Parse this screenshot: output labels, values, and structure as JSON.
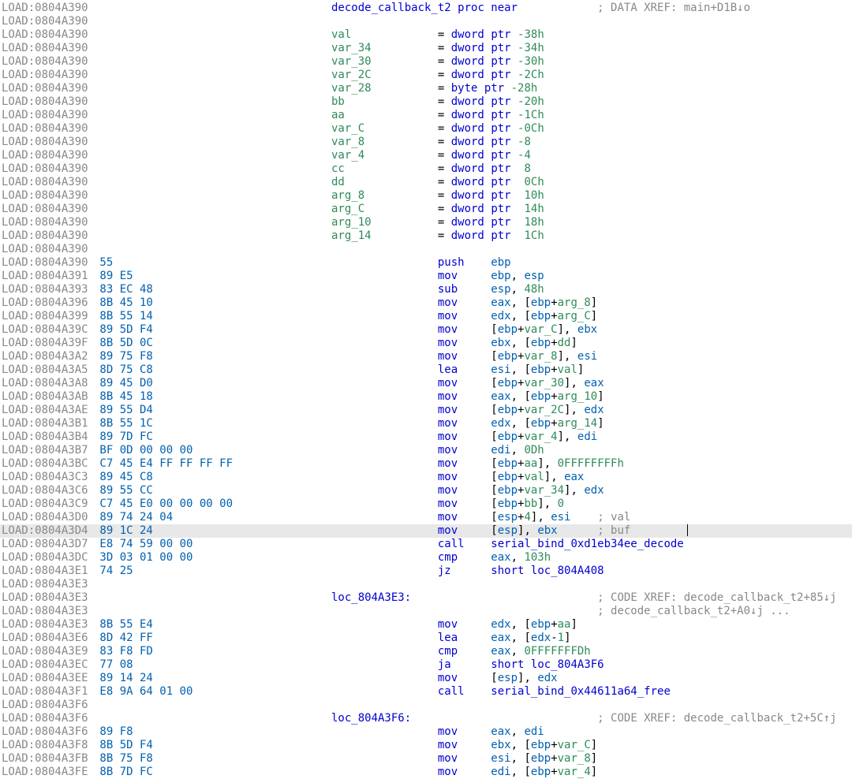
{
  "segment": "LOAD",
  "header_addr": "0804A390",
  "proc_name": "decode_callback_t2",
  "proc_keyword": "proc near",
  "proc_xref": "; DATA XREF: main+D1B↓o",
  "vars": [
    {
      "name": "val",
      "type": "dword",
      "off": "-38h"
    },
    {
      "name": "var_34",
      "type": "dword",
      "off": "-34h"
    },
    {
      "name": "var_30",
      "type": "dword",
      "off": "-30h"
    },
    {
      "name": "var_2C",
      "type": "dword",
      "off": "-2Ch"
    },
    {
      "name": "var_28",
      "type": "byte",
      "off": "-28h"
    },
    {
      "name": "bb",
      "type": "dword",
      "off": "-20h"
    },
    {
      "name": "aa",
      "type": "dword",
      "off": "-1Ch"
    },
    {
      "name": "var_C",
      "type": "dword",
      "off": "-0Ch"
    },
    {
      "name": "var_8",
      "type": "dword",
      "off": "-8"
    },
    {
      "name": "var_4",
      "type": "dword",
      "off": "-4"
    },
    {
      "name": "cc",
      "type": "dword",
      "off": " 8"
    },
    {
      "name": "dd",
      "type": "dword",
      "off": " 0Ch"
    },
    {
      "name": "arg_8",
      "type": "dword",
      "off": " 10h"
    },
    {
      "name": "arg_C",
      "type": "dword",
      "off": " 14h"
    },
    {
      "name": "arg_10",
      "type": "dword",
      "off": " 18h"
    },
    {
      "name": "arg_14",
      "type": "dword",
      "off": " 1Ch"
    }
  ],
  "rows": [
    {
      "addr": "0804A390",
      "bytes": "55",
      "mnem": "push",
      "ops": [
        {
          "t": "reg",
          "v": "ebp"
        }
      ]
    },
    {
      "addr": "0804A391",
      "bytes": "89 E5",
      "mnem": "mov",
      "ops": [
        {
          "t": "reg",
          "v": "ebp"
        },
        {
          "t": "p",
          "v": ", "
        },
        {
          "t": "reg",
          "v": "esp"
        }
      ]
    },
    {
      "addr": "0804A393",
      "bytes": "83 EC 48",
      "mnem": "sub",
      "ops": [
        {
          "t": "reg",
          "v": "esp"
        },
        {
          "t": "p",
          "v": ", "
        },
        {
          "t": "num",
          "v": "48h"
        }
      ]
    },
    {
      "addr": "0804A396",
      "bytes": "8B 45 10",
      "mnem": "mov",
      "ops": [
        {
          "t": "reg",
          "v": "eax"
        },
        {
          "t": "p",
          "v": ", ["
        },
        {
          "t": "reg",
          "v": "ebp"
        },
        {
          "t": "p",
          "v": "+"
        },
        {
          "t": "var",
          "v": "arg_8"
        },
        {
          "t": "p",
          "v": "]"
        }
      ]
    },
    {
      "addr": "0804A399",
      "bytes": "8B 55 14",
      "mnem": "mov",
      "ops": [
        {
          "t": "reg",
          "v": "edx"
        },
        {
          "t": "p",
          "v": ", ["
        },
        {
          "t": "reg",
          "v": "ebp"
        },
        {
          "t": "p",
          "v": "+"
        },
        {
          "t": "var",
          "v": "arg_C"
        },
        {
          "t": "p",
          "v": "]"
        }
      ]
    },
    {
      "addr": "0804A39C",
      "bytes": "89 5D F4",
      "mnem": "mov",
      "ops": [
        {
          "t": "p",
          "v": "["
        },
        {
          "t": "reg",
          "v": "ebp"
        },
        {
          "t": "p",
          "v": "+"
        },
        {
          "t": "var",
          "v": "var_C"
        },
        {
          "t": "p",
          "v": "], "
        },
        {
          "t": "reg",
          "v": "ebx"
        }
      ]
    },
    {
      "addr": "0804A39F",
      "bytes": "8B 5D 0C",
      "mnem": "mov",
      "ops": [
        {
          "t": "reg",
          "v": "ebx"
        },
        {
          "t": "p",
          "v": ", ["
        },
        {
          "t": "reg",
          "v": "ebp"
        },
        {
          "t": "p",
          "v": "+"
        },
        {
          "t": "var",
          "v": "dd"
        },
        {
          "t": "p",
          "v": "]"
        }
      ]
    },
    {
      "addr": "0804A3A2",
      "bytes": "89 75 F8",
      "mnem": "mov",
      "ops": [
        {
          "t": "p",
          "v": "["
        },
        {
          "t": "reg",
          "v": "ebp"
        },
        {
          "t": "p",
          "v": "+"
        },
        {
          "t": "var",
          "v": "var_8"
        },
        {
          "t": "p",
          "v": "], "
        },
        {
          "t": "reg",
          "v": "esi"
        }
      ]
    },
    {
      "addr": "0804A3A5",
      "bytes": "8D 75 C8",
      "mnem": "lea",
      "ops": [
        {
          "t": "reg",
          "v": "esi"
        },
        {
          "t": "p",
          "v": ", ["
        },
        {
          "t": "reg",
          "v": "ebp"
        },
        {
          "t": "p",
          "v": "+"
        },
        {
          "t": "var",
          "v": "val"
        },
        {
          "t": "p",
          "v": "]"
        }
      ]
    },
    {
      "addr": "0804A3A8",
      "bytes": "89 45 D0",
      "mnem": "mov",
      "ops": [
        {
          "t": "p",
          "v": "["
        },
        {
          "t": "reg",
          "v": "ebp"
        },
        {
          "t": "p",
          "v": "+"
        },
        {
          "t": "var",
          "v": "var_30"
        },
        {
          "t": "p",
          "v": "], "
        },
        {
          "t": "reg",
          "v": "eax"
        }
      ]
    },
    {
      "addr": "0804A3AB",
      "bytes": "8B 45 18",
      "mnem": "mov",
      "ops": [
        {
          "t": "reg",
          "v": "eax"
        },
        {
          "t": "p",
          "v": ", ["
        },
        {
          "t": "reg",
          "v": "ebp"
        },
        {
          "t": "p",
          "v": "+"
        },
        {
          "t": "var",
          "v": "arg_10"
        },
        {
          "t": "p",
          "v": "]"
        }
      ]
    },
    {
      "addr": "0804A3AE",
      "bytes": "89 55 D4",
      "mnem": "mov",
      "ops": [
        {
          "t": "p",
          "v": "["
        },
        {
          "t": "reg",
          "v": "ebp"
        },
        {
          "t": "p",
          "v": "+"
        },
        {
          "t": "var",
          "v": "var_2C"
        },
        {
          "t": "p",
          "v": "], "
        },
        {
          "t": "reg",
          "v": "edx"
        }
      ]
    },
    {
      "addr": "0804A3B1",
      "bytes": "8B 55 1C",
      "mnem": "mov",
      "ops": [
        {
          "t": "reg",
          "v": "edx"
        },
        {
          "t": "p",
          "v": ", ["
        },
        {
          "t": "reg",
          "v": "ebp"
        },
        {
          "t": "p",
          "v": "+"
        },
        {
          "t": "var",
          "v": "arg_14"
        },
        {
          "t": "p",
          "v": "]"
        }
      ]
    },
    {
      "addr": "0804A3B4",
      "bytes": "89 7D FC",
      "mnem": "mov",
      "ops": [
        {
          "t": "p",
          "v": "["
        },
        {
          "t": "reg",
          "v": "ebp"
        },
        {
          "t": "p",
          "v": "+"
        },
        {
          "t": "var",
          "v": "var_4"
        },
        {
          "t": "p",
          "v": "], "
        },
        {
          "t": "reg",
          "v": "edi"
        }
      ]
    },
    {
      "addr": "0804A3B7",
      "bytes": "BF 0D 00 00 00",
      "mnem": "mov",
      "ops": [
        {
          "t": "reg",
          "v": "edi"
        },
        {
          "t": "p",
          "v": ", "
        },
        {
          "t": "num",
          "v": "0Dh"
        }
      ]
    },
    {
      "addr": "0804A3BC",
      "bytes": "C7 45 E4 FF FF FF FF",
      "mnem": "mov",
      "ops": [
        {
          "t": "p",
          "v": "["
        },
        {
          "t": "reg",
          "v": "ebp"
        },
        {
          "t": "p",
          "v": "+"
        },
        {
          "t": "var",
          "v": "aa"
        },
        {
          "t": "p",
          "v": "], "
        },
        {
          "t": "num",
          "v": "0FFFFFFFFh"
        }
      ]
    },
    {
      "addr": "0804A3C3",
      "bytes": "89 45 C8",
      "mnem": "mov",
      "ops": [
        {
          "t": "p",
          "v": "["
        },
        {
          "t": "reg",
          "v": "ebp"
        },
        {
          "t": "p",
          "v": "+"
        },
        {
          "t": "var",
          "v": "val"
        },
        {
          "t": "p",
          "v": "], "
        },
        {
          "t": "reg",
          "v": "eax"
        }
      ]
    },
    {
      "addr": "0804A3C6",
      "bytes": "89 55 CC",
      "mnem": "mov",
      "ops": [
        {
          "t": "p",
          "v": "["
        },
        {
          "t": "reg",
          "v": "ebp"
        },
        {
          "t": "p",
          "v": "+"
        },
        {
          "t": "var",
          "v": "var_34"
        },
        {
          "t": "p",
          "v": "], "
        },
        {
          "t": "reg",
          "v": "edx"
        }
      ]
    },
    {
      "addr": "0804A3C9",
      "bytes": "C7 45 E0 00 00 00 00",
      "mnem": "mov",
      "ops": [
        {
          "t": "p",
          "v": "["
        },
        {
          "t": "reg",
          "v": "ebp"
        },
        {
          "t": "p",
          "v": "+"
        },
        {
          "t": "var",
          "v": "bb"
        },
        {
          "t": "p",
          "v": "], "
        },
        {
          "t": "num",
          "v": "0"
        }
      ]
    },
    {
      "addr": "0804A3D0",
      "bytes": "89 74 24 04",
      "mnem": "mov",
      "ops": [
        {
          "t": "p",
          "v": "["
        },
        {
          "t": "reg",
          "v": "esp"
        },
        {
          "t": "p",
          "v": "+"
        },
        {
          "t": "num",
          "v": "4"
        },
        {
          "t": "p",
          "v": "], "
        },
        {
          "t": "reg",
          "v": "esi"
        }
      ],
      "tail_comment": "    ; val"
    },
    {
      "addr": "0804A3D4",
      "bytes": "89 1C 24",
      "mnem": "mov",
      "ops": [
        {
          "t": "p",
          "v": "["
        },
        {
          "t": "reg",
          "v": "esp"
        },
        {
          "t": "p",
          "v": "], "
        },
        {
          "t": "reg",
          "v": "ebx"
        }
      ],
      "tail_comment": "      ; buf",
      "highlight": true
    },
    {
      "addr": "0804A3D7",
      "bytes": "E8 74 59 00 00",
      "mnem": "call",
      "ops": [
        {
          "t": "id",
          "v": "serial_bind_0xd1eb34ee_decode"
        }
      ]
    },
    {
      "addr": "0804A3DC",
      "bytes": "3D 03 01 00 00",
      "mnem": "cmp",
      "ops": [
        {
          "t": "reg",
          "v": "eax"
        },
        {
          "t": "p",
          "v": ", "
        },
        {
          "t": "num",
          "v": "103h"
        }
      ]
    },
    {
      "addr": "0804A3E1",
      "bytes": "74 25",
      "mnem": "jz",
      "ops": [
        {
          "t": "key",
          "v": "short"
        },
        {
          "t": "p",
          "v": " "
        },
        {
          "t": "id",
          "v": "loc_804A408"
        }
      ]
    },
    {
      "addr": "0804A3E3",
      "blank": true
    },
    {
      "addr": "0804A3E3",
      "label": "loc_804A3E3:",
      "xref": "; CODE XREF: decode_callback_t2+85↓j"
    },
    {
      "addr": "0804A3E3",
      "xref_only": "; decode_callback_t2+A0↓j ..."
    },
    {
      "addr": "0804A3E3",
      "bytes": "8B 55 E4",
      "mnem": "mov",
      "ops": [
        {
          "t": "reg",
          "v": "edx"
        },
        {
          "t": "p",
          "v": ", ["
        },
        {
          "t": "reg",
          "v": "ebp"
        },
        {
          "t": "p",
          "v": "+"
        },
        {
          "t": "var",
          "v": "aa"
        },
        {
          "t": "p",
          "v": "]"
        }
      ]
    },
    {
      "addr": "0804A3E6",
      "bytes": "8D 42 FF",
      "mnem": "lea",
      "ops": [
        {
          "t": "reg",
          "v": "eax"
        },
        {
          "t": "p",
          "v": ", ["
        },
        {
          "t": "reg",
          "v": "edx"
        },
        {
          "t": "p",
          "v": "-"
        },
        {
          "t": "num",
          "v": "1"
        },
        {
          "t": "p",
          "v": "]"
        }
      ]
    },
    {
      "addr": "0804A3E9",
      "bytes": "83 F8 FD",
      "mnem": "cmp",
      "ops": [
        {
          "t": "reg",
          "v": "eax"
        },
        {
          "t": "p",
          "v": ", "
        },
        {
          "t": "num",
          "v": "0FFFFFFFDh"
        }
      ]
    },
    {
      "addr": "0804A3EC",
      "bytes": "77 08",
      "mnem": "ja",
      "ops": [
        {
          "t": "key",
          "v": "short"
        },
        {
          "t": "p",
          "v": " "
        },
        {
          "t": "id",
          "v": "loc_804A3F6"
        }
      ]
    },
    {
      "addr": "0804A3EE",
      "bytes": "89 14 24",
      "mnem": "mov",
      "ops": [
        {
          "t": "p",
          "v": "["
        },
        {
          "t": "reg",
          "v": "esp"
        },
        {
          "t": "p",
          "v": "], "
        },
        {
          "t": "reg",
          "v": "edx"
        }
      ]
    },
    {
      "addr": "0804A3F1",
      "bytes": "E8 9A 64 01 00",
      "mnem": "call",
      "ops": [
        {
          "t": "id",
          "v": "serial_bind_0x44611a64_free"
        }
      ]
    },
    {
      "addr": "0804A3F6",
      "blank": true
    },
    {
      "addr": "0804A3F6",
      "label": "loc_804A3F6:",
      "xref": "; CODE XREF: decode_callback_t2+5C↑j"
    },
    {
      "addr": "0804A3F6",
      "bytes": "89 F8",
      "mnem": "mov",
      "ops": [
        {
          "t": "reg",
          "v": "eax"
        },
        {
          "t": "p",
          "v": ", "
        },
        {
          "t": "reg",
          "v": "edi"
        }
      ]
    },
    {
      "addr": "0804A3F8",
      "bytes": "8B 5D F4",
      "mnem": "mov",
      "ops": [
        {
          "t": "reg",
          "v": "ebx"
        },
        {
          "t": "p",
          "v": ", ["
        },
        {
          "t": "reg",
          "v": "ebp"
        },
        {
          "t": "p",
          "v": "+"
        },
        {
          "t": "var",
          "v": "var_C"
        },
        {
          "t": "p",
          "v": "]"
        }
      ]
    },
    {
      "addr": "0804A3FB",
      "bytes": "8B 75 F8",
      "mnem": "mov",
      "ops": [
        {
          "t": "reg",
          "v": "esi"
        },
        {
          "t": "p",
          "v": ", ["
        },
        {
          "t": "reg",
          "v": "ebp"
        },
        {
          "t": "p",
          "v": "+"
        },
        {
          "t": "var",
          "v": "var_8"
        },
        {
          "t": "p",
          "v": "]"
        }
      ]
    },
    {
      "addr": "0804A3FE",
      "bytes": "8B 7D FC",
      "mnem": "mov",
      "ops": [
        {
          "t": "reg",
          "v": "edi"
        },
        {
          "t": "p",
          "v": ", ["
        },
        {
          "t": "reg",
          "v": "ebp"
        },
        {
          "t": "p",
          "v": "+"
        },
        {
          "t": "var",
          "v": "var_4"
        },
        {
          "t": "p",
          "v": "]"
        }
      ]
    }
  ],
  "strings": {
    "ptr": "ptr"
  }
}
